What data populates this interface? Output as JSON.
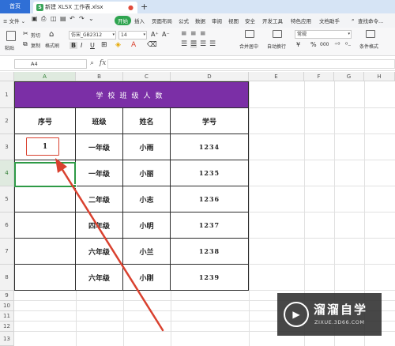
{
  "titlebar": {
    "home_tab": "首页",
    "file_tab": "新建 XLSX 工作表.xlsx",
    "file_badge": "S",
    "new_tab": "+"
  },
  "menubar": {
    "file_menu": "≡ 文件 ⌄",
    "items": [
      "开始",
      "插入",
      "页面布局",
      "公式",
      "数据",
      "审阅",
      "视图",
      "安全",
      "开发工具",
      "特色应用",
      "文档助手"
    ],
    "active_item": "开始",
    "search": "查找命令..."
  },
  "ribbon": {
    "paste": "粘贴",
    "cut": "剪切",
    "copy": "复制",
    "format_painter": "格式刷",
    "font_name": "仿宋_GB2312",
    "font_size": "14",
    "merge_center": "合并居中",
    "wrap_text": "自动换行",
    "number_format": "常规",
    "percent": "%",
    "thousands": "000",
    "conditional_format": "条件格式",
    "bold": "B",
    "italic": "I",
    "underline": "U"
  },
  "formula_bar": {
    "cell_ref": "A4",
    "fx": "fx",
    "value": ""
  },
  "columns": [
    "A",
    "B",
    "C",
    "D",
    "E",
    "F",
    "G",
    "H"
  ],
  "rows": [
    "1",
    "2",
    "3",
    "4",
    "5",
    "6",
    "7",
    "8",
    "9",
    "10",
    "11",
    "12",
    "13"
  ],
  "table": {
    "title": "学校班级人数",
    "headers": [
      "序号",
      "班级",
      "姓名",
      "学号"
    ],
    "rows": [
      [
        "1",
        "一年级",
        "小雨",
        "1234"
      ],
      [
        "",
        "一年级",
        "小丽",
        "1235"
      ],
      [
        "",
        "二年级",
        "小志",
        "1236"
      ],
      [
        "",
        "四年级",
        "小明",
        "1237"
      ],
      [
        "",
        "六年级",
        "小兰",
        "1238"
      ],
      [
        "",
        "六年级",
        "小刚",
        "1239"
      ]
    ]
  },
  "watermark": {
    "brand_cn": "溜溜自学",
    "url": "ZIXUE.3D66.COM"
  },
  "colors": {
    "title_fill": "#7b2fa6",
    "annotation_red": "#d9412f",
    "selection_green": "#2e9a46"
  }
}
